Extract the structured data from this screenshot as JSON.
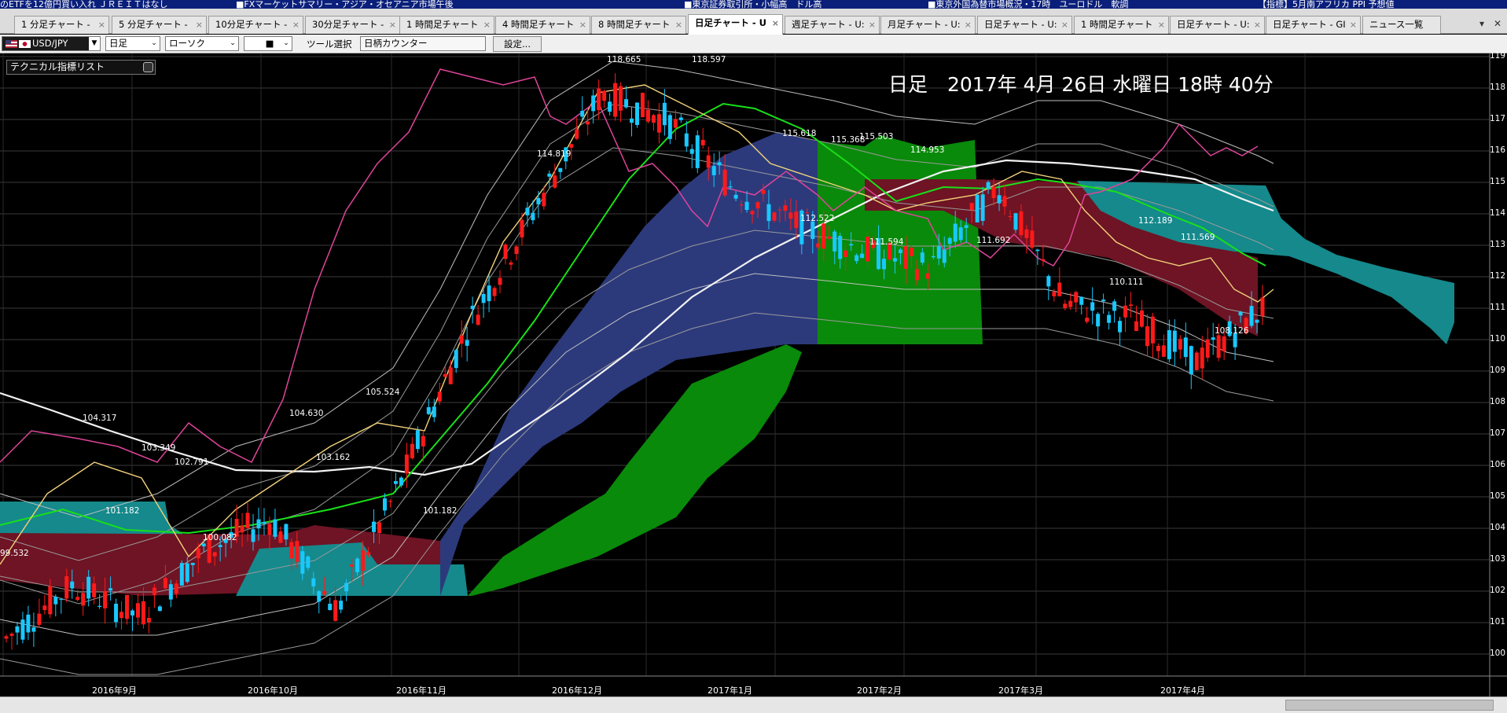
{
  "ticker": [
    "のETFを12億円買い入れ ＪＲＥＩＴはなし",
    "■FXマーケットサマリー・アジア・オセアニア市場午後",
    "■東京証券取引所・小幅高　ドル高",
    "■東京外国為替市場概況・17時　ユーロドル　軟調",
    "【指標】5月南アフリカ PPI 予想値"
  ],
  "tabs": [
    {
      "label": "1 分足チャート - "
    },
    {
      "label": "5 分足チャート - "
    },
    {
      "label": "10分足チャート - "
    },
    {
      "label": "30分足チャート - "
    },
    {
      "label": "1 時間足チャート"
    },
    {
      "label": "4 時間足チャート"
    },
    {
      "label": "8 時間足チャート"
    },
    {
      "label": "日足チャート - U"
    },
    {
      "label": "週足チャート - U:"
    },
    {
      "label": "月足チャート - U:"
    },
    {
      "label": "日足チャート - U:"
    },
    {
      "label": "1 時間足チャート"
    },
    {
      "label": "日足チャート - U:"
    },
    {
      "label": "日足チャート - GI"
    },
    {
      "label": "ニュース一覧"
    }
  ],
  "toolbar": {
    "symbol": "USD/JPY",
    "period": "日足",
    "chart_type": "ローソク",
    "line_style": "■",
    "tool_label": "ツール選択",
    "tool_value": "日柄カウンター",
    "settings_button": "設定..."
  },
  "chart": {
    "indicator_list": "テクニカル指標リスト",
    "title": "日足　2017年 4月 26日 水曜日 18時 40分",
    "y_ticks": [
      "119",
      "118",
      "117",
      "116",
      "115",
      "114",
      "113",
      "112",
      "111",
      "110",
      "109",
      "108",
      "107",
      "106",
      "105",
      "104",
      "103",
      "102",
      "101",
      "100"
    ],
    "x_labels": [
      "2016年9月",
      "2016年10月",
      "2016年11月",
      "2016年12月",
      "2017年1月",
      "2017年2月",
      "2017年3月",
      "2017年4月"
    ],
    "annotations": [
      {
        "text": "118.665"
      },
      {
        "text": "118.597"
      },
      {
        "text": "114.819"
      },
      {
        "text": "115.618"
      },
      {
        "text": "115.368"
      },
      {
        "text": "114.953"
      },
      {
        "text": "115.503"
      },
      {
        "text": "112.522"
      },
      {
        "text": "111.594"
      },
      {
        "text": "111.692"
      },
      {
        "text": "112.189"
      },
      {
        "text": "111.569"
      },
      {
        "text": "110.111"
      },
      {
        "text": "108.126"
      },
      {
        "text": "105.524"
      },
      {
        "text": "104.630"
      },
      {
        "text": "104.317"
      },
      {
        "text": "103.349"
      },
      {
        "text": "102.791"
      },
      {
        "text": "103.162"
      },
      {
        "text": "101.182"
      },
      {
        "text": "101.182"
      },
      {
        "text": "100.082"
      },
      {
        "text": "99.532"
      }
    ]
  },
  "colors": {
    "background": "#000000",
    "up_candle": "#ff1a1a",
    "down_candle": "#19c8ff",
    "cloud_cyan": "#15898c",
    "cloud_maroon": "#6e1424",
    "cloud_navy": "#2c3a7c",
    "cloud_green": "#0a8a0a",
    "rsi_line": "#e0449a"
  },
  "chart_data": {
    "type": "candlestick",
    "instrument": "USD/JPY",
    "period": "日足",
    "ylim": [
      99.5,
      119
    ],
    "x": [
      "2016-08-25",
      "2016-09-08",
      "2016-09-22",
      "2016-10-06",
      "2016-10-20",
      "2016-11-03",
      "2016-11-10",
      "2016-11-17",
      "2016-12-01",
      "2016-12-15",
      "2016-12-29",
      "2017-01-12",
      "2017-01-26",
      "2017-02-09",
      "2017-02-23",
      "2017-03-09",
      "2017-03-23",
      "2017-04-06",
      "2017-04-20",
      "2017-04-26"
    ],
    "close": [
      100.5,
      102.2,
      101.2,
      103.3,
      104.3,
      101.4,
      105.6,
      110.5,
      114.2,
      117.8,
      117.0,
      114.8,
      113.6,
      112.8,
      112.3,
      114.9,
      111.1,
      110.7,
      109.3,
      111.0
    ]
  }
}
